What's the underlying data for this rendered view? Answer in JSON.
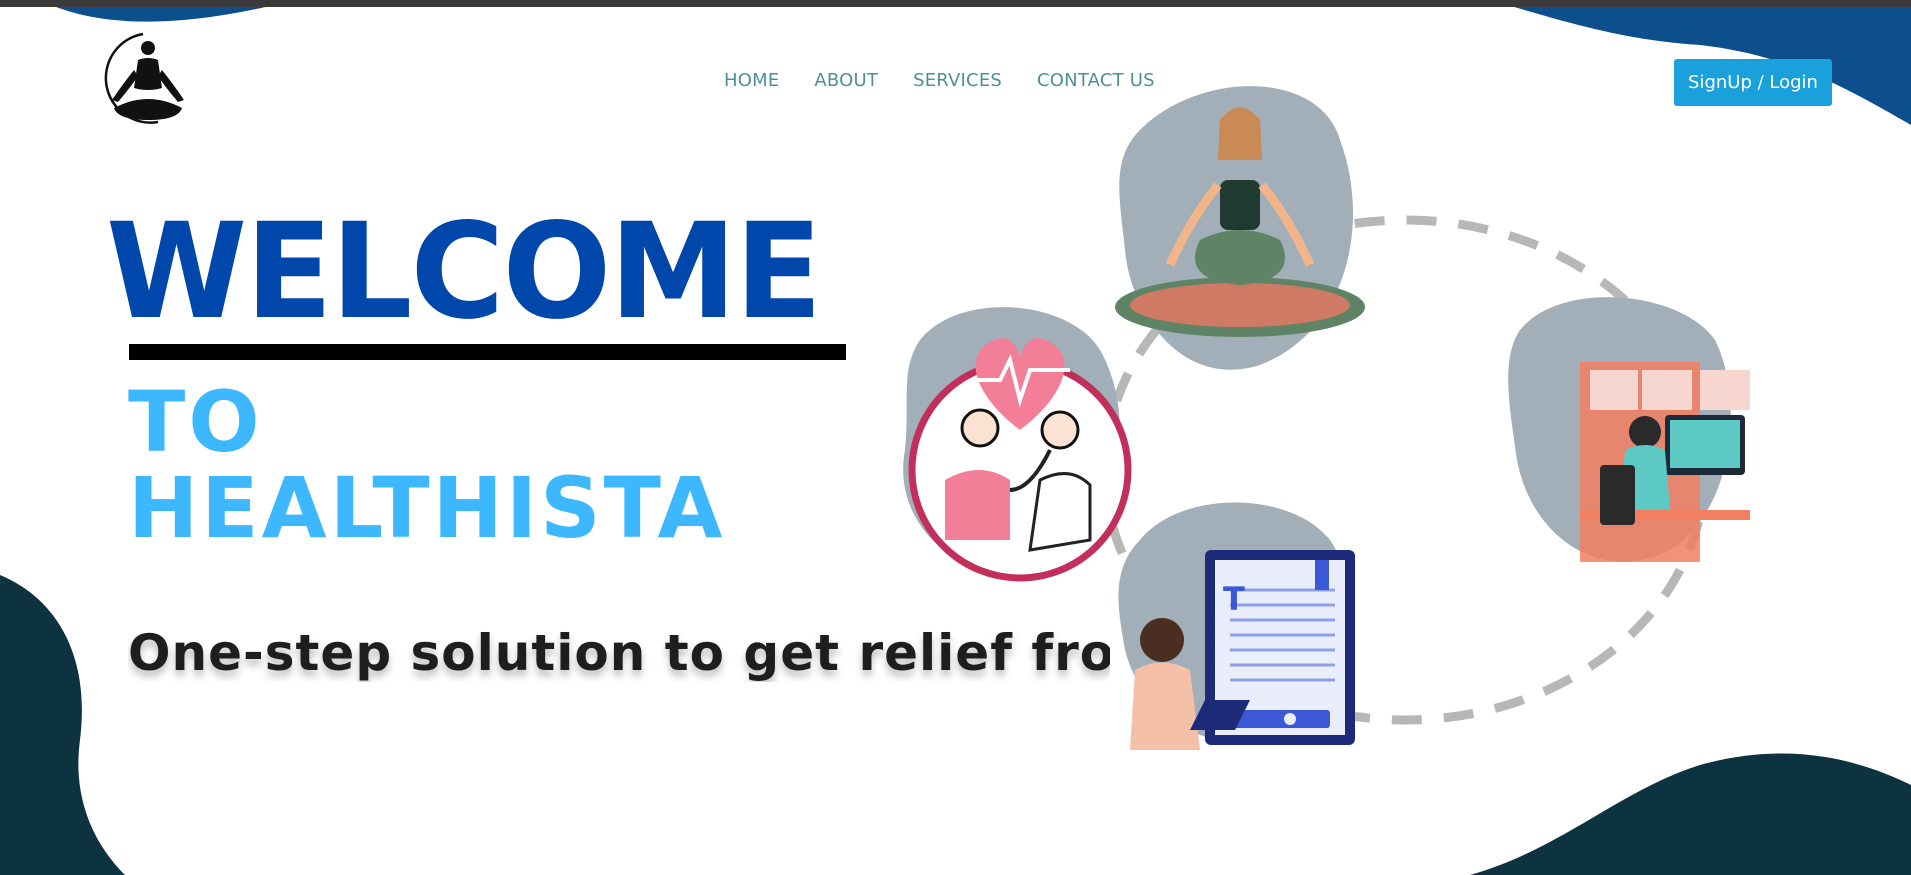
{
  "nav": {
    "items": [
      {
        "label": "HOME"
      },
      {
        "label": "ABOUT"
      },
      {
        "label": "SERVICES"
      },
      {
        "label": "CONTACT US"
      }
    ]
  },
  "auth": {
    "signup_label": "SignUp / Login"
  },
  "hero": {
    "title": "WELCOME",
    "line2": "TO",
    "line3": "HEALTHISTA",
    "tagline": "One-step solution to get relief from st"
  },
  "colors": {
    "title_blue": "#0047ab",
    "subtitle_blue": "#3db8ff",
    "nav_text": "#4f8f9a",
    "button_bg": "#1aa0db",
    "dark_wave": "#0e3340",
    "blue_wave": "#0d4f8c",
    "blob_gray": "#a2aeb8"
  },
  "icons": {
    "logo": "meditation-logo-icon",
    "meditation": "meditation-woman-icon",
    "doctor": "doctor-checkup-icon",
    "remote_work": "remote-work-icon",
    "online_learning": "online-learning-icon"
  }
}
